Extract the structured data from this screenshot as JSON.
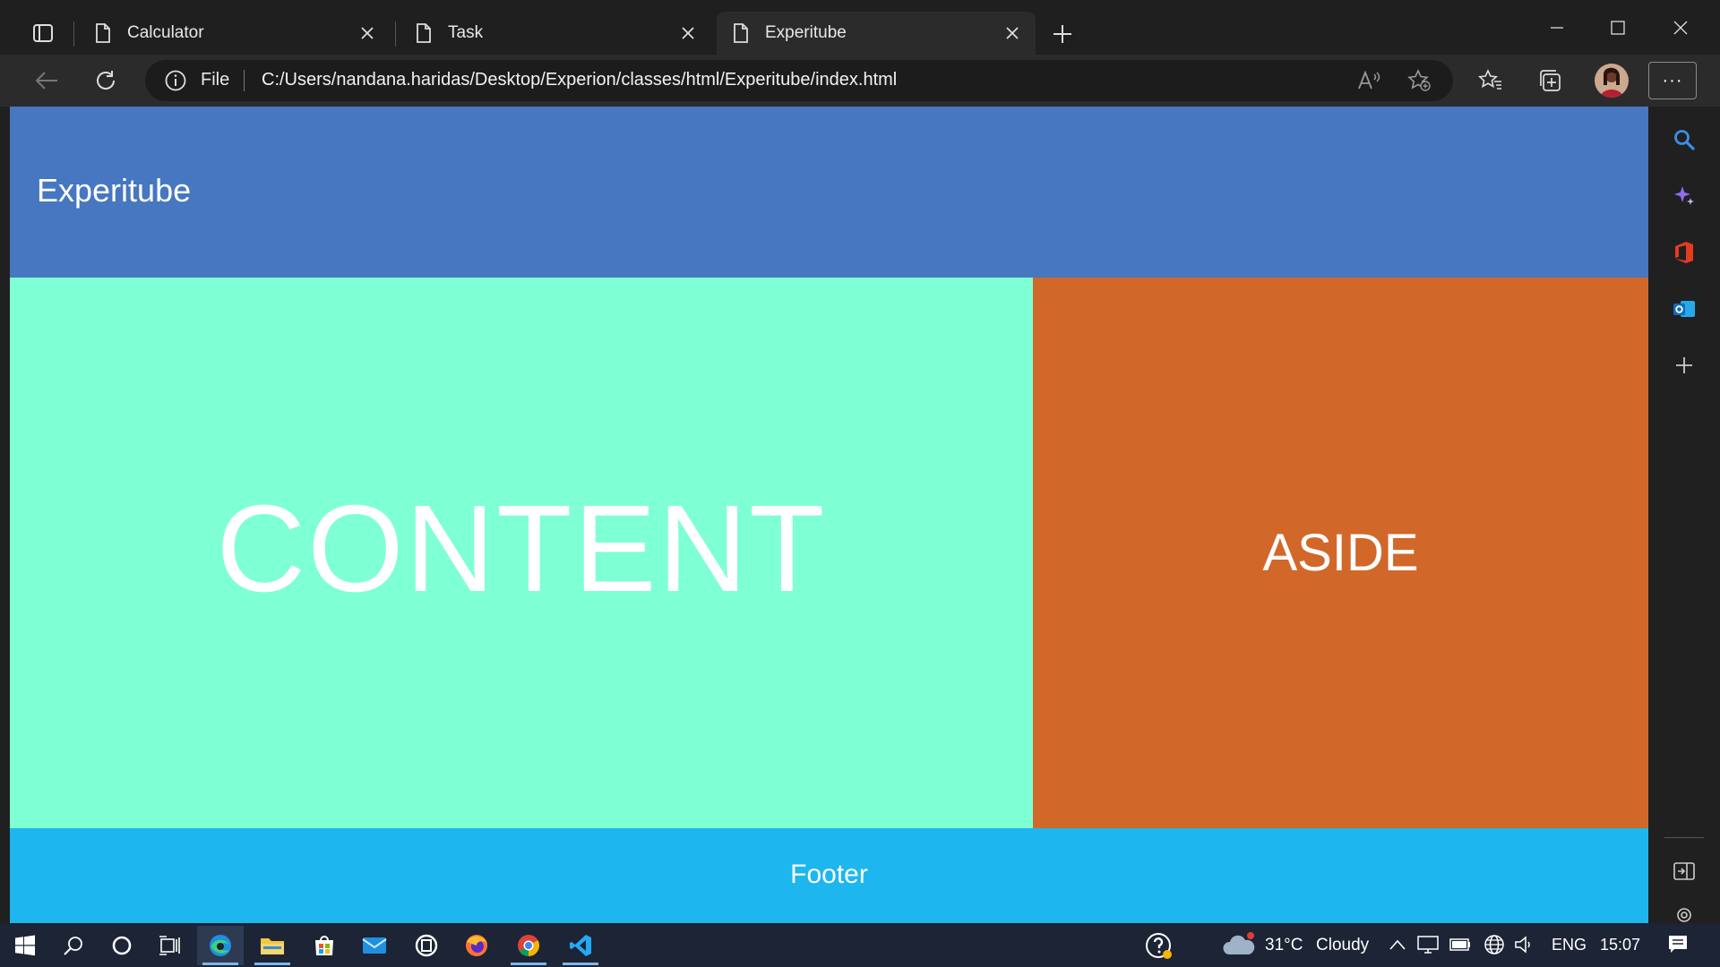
{
  "browser": {
    "tabs": [
      {
        "label": "Calculator",
        "icon": "page-icon",
        "active": false
      },
      {
        "label": "Task",
        "icon": "page-icon",
        "active": false
      },
      {
        "label": "Experitube",
        "icon": "page-icon",
        "active": true
      }
    ],
    "address": {
      "scheme_label": "File",
      "url": "C:/Users/nandana.haridas/Desktop/Experion/classes/html/Experitube/index.html"
    },
    "more_label": "···"
  },
  "page": {
    "header_title": "Experitube",
    "content_text": "CONTENT",
    "aside_text": "ASIDE",
    "footer_text": "Footer",
    "colors": {
      "header": "#4677c0",
      "content": "#7fffd4",
      "aside": "#d2672a",
      "footer": "#1eb6ef"
    }
  },
  "sidebar": {
    "items": [
      "search-icon",
      "copilot-icon",
      "office-icon",
      "outlook-icon",
      "add-icon",
      "split-screen-icon"
    ]
  },
  "taskbar": {
    "weather": {
      "temp": "31°C",
      "condition": "Cloudy"
    },
    "language": "ENG",
    "time": "15:07"
  }
}
